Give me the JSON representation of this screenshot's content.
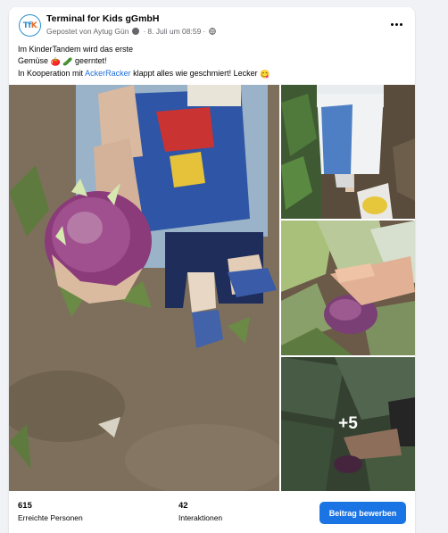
{
  "post": {
    "page_name": "Terminal for Kids gGmbH",
    "avatar_text_a": "Tf",
    "avatar_text_b": "K",
    "author_line": "Gepostet von Aytug Gün",
    "date": "8. Juli um 08:59",
    "separator": "·",
    "text": {
      "line1": "Im KinderTandem wird das erste",
      "line2_a": "Gemüse",
      "line2_emoji1": "🍅",
      "line2_emoji2": "🥒",
      "line2_b": "geerntet!",
      "line3_a": "In Kooperation mit",
      "line3_link": "AckerRacker",
      "line3_b": "klappt alles wie geschmiert! Lecker",
      "line3_emoji": "😋"
    }
  },
  "gallery": {
    "more_count": "+5"
  },
  "stats": {
    "reach_value": "615",
    "reach_label": "Erreichte Personen",
    "interactions_value": "42",
    "interactions_label": "Interaktionen",
    "boost_label": "Beitrag bewerben"
  },
  "colors": {
    "brand_blue": "#1b74e4",
    "link_blue": "#216fdb",
    "secondary_text": "#65676b"
  }
}
